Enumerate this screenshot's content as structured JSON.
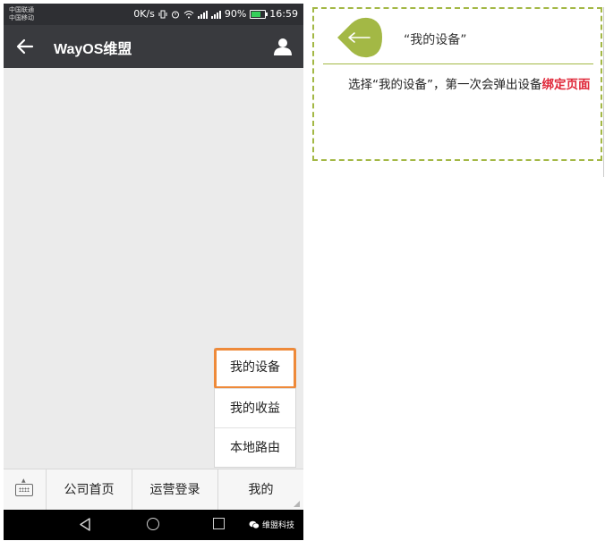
{
  "status_bar": {
    "carrier_1": "中国联通",
    "carrier_2": "中国移动",
    "speed": "0K/s",
    "battery": "90%",
    "time": "16:59"
  },
  "title_bar": {
    "title": "WayOS维盟",
    "icons": [
      "back-arrow-icon",
      "profile-icon"
    ]
  },
  "popup_menu": {
    "items": [
      {
        "label": "我的设备",
        "highlighted": true
      },
      {
        "label": "我的收益",
        "highlighted": false
      },
      {
        "label": "本地路由",
        "highlighted": false
      }
    ],
    "highlight_color": "#ee8a3a"
  },
  "bottom_menu": {
    "tabs": [
      "公司首页",
      "运营登录",
      "我的"
    ]
  },
  "nav_bar": {
    "brand": "维盟科技"
  },
  "annotation": {
    "title": "“我的设备”",
    "text_normal": "选择“我的设备”，第一次会弹出设备",
    "text_highlight": "绑定页面",
    "accent_color": "#a3b845",
    "highlight_color": "#e0283a"
  }
}
